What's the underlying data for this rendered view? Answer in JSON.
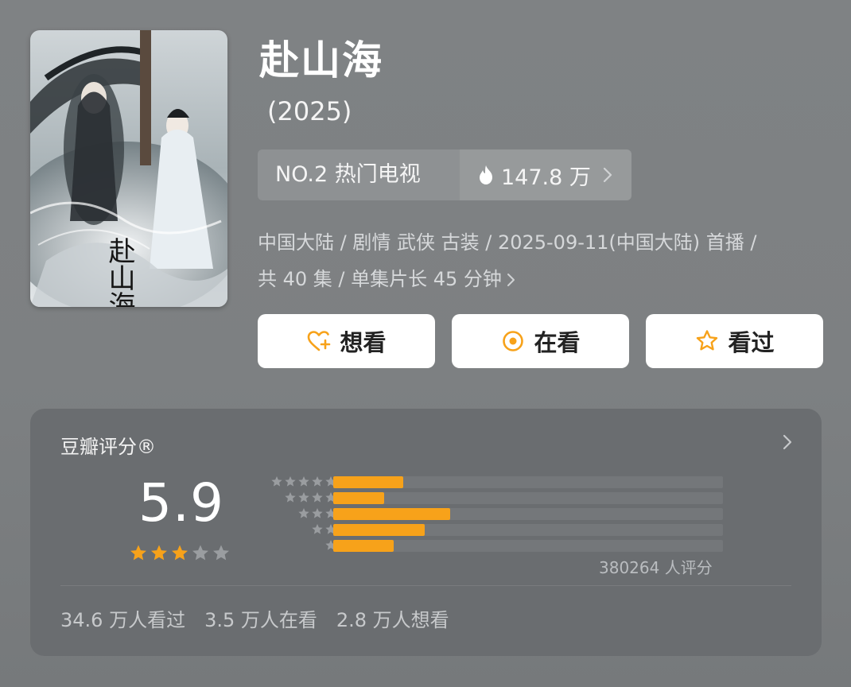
{
  "show": {
    "title": "赴山海",
    "year": "(2025)",
    "poster_title": "赴山海"
  },
  "rank": {
    "label": "NO.2 热门电视",
    "hot_value": "147.8 万",
    "icon": "flame-icon"
  },
  "meta": {
    "line1": "中国大陆 / 剧情 武侠 古装 / 2025-09-11(中国大陆) 首播 /",
    "line2": "共 40 集 / 单集片长 45 分钟"
  },
  "actions": [
    {
      "label": "想看",
      "icon": "heart-plus-icon"
    },
    {
      "label": "在看",
      "icon": "circle-dot-icon"
    },
    {
      "label": "看过",
      "icon": "star-outline-icon"
    }
  ],
  "rating": {
    "title": "豆瓣评分®",
    "score": "5.9",
    "stars_filled": 3,
    "stars_total": 5,
    "raters": "380264 人评分",
    "distribution": [
      {
        "stars": 5,
        "fraction": 0.18
      },
      {
        "stars": 4,
        "fraction": 0.13
      },
      {
        "stars": 3,
        "fraction": 0.3
      },
      {
        "stars": 2,
        "fraction": 0.235
      },
      {
        "stars": 1,
        "fraction": 0.155
      }
    ],
    "stats": [
      "34.6 万人看过",
      "3.5 万人在看",
      "2.8 万人想看"
    ]
  },
  "colors": {
    "accent": "#f7a21a",
    "bar_track": "#74777a",
    "card_bg": "#6a6d70"
  }
}
